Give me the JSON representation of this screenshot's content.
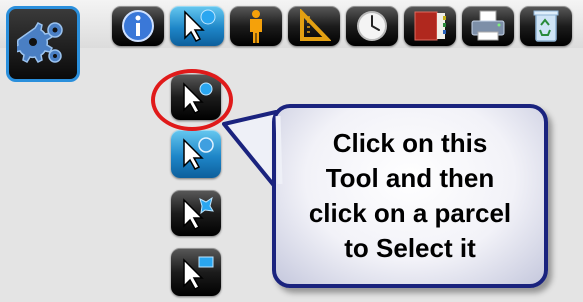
{
  "toolbar": {
    "items": [
      {
        "icon": "info-icon",
        "label": "Info"
      },
      {
        "icon": "select-arrow-icon",
        "label": "Select"
      },
      {
        "icon": "person-icon",
        "label": "Person"
      },
      {
        "icon": "triangle-ruler-icon",
        "label": "Measure"
      },
      {
        "icon": "clock-icon",
        "label": "Clock"
      },
      {
        "icon": "book-icon",
        "label": "Book"
      },
      {
        "icon": "printer-icon",
        "label": "Print"
      },
      {
        "icon": "recycle-bin-icon",
        "label": "Recycle bin"
      }
    ]
  },
  "settings_button": {
    "icon": "gears-icon"
  },
  "select_flyout": {
    "items": [
      {
        "icon": "select-point-icon",
        "active": false
      },
      {
        "icon": "select-circle-icon",
        "active": true
      },
      {
        "icon": "select-shape-icon",
        "active": false
      },
      {
        "icon": "select-rectangle-icon",
        "active": false
      }
    ]
  },
  "callout": {
    "line1": "Click on this",
    "line2": "Tool and then",
    "line3": "click on a parcel",
    "line4": "to Select it"
  },
  "colors": {
    "highlight_ring": "#e01a1a",
    "callout_border": "#1a237e",
    "accent_blue": "#2a8fdc"
  }
}
